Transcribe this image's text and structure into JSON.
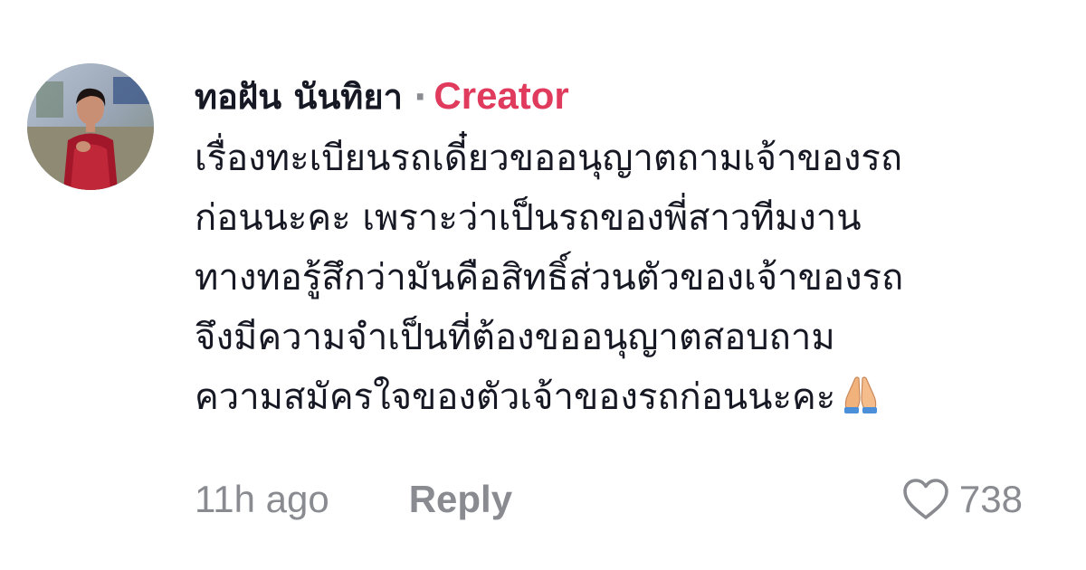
{
  "comment": {
    "username": "ทอฝัน นันทิยา",
    "separator": "·",
    "badge": "Creator",
    "text_lines": [
      "เรื่องทะเบียนรถเดี๋ยวขออนุญาตถามเจ้าของรถ",
      "ก่อนนะคะ เพราะว่าเป็นรถของพี่สาวทีมงาน",
      "ทางทอรู้สึกว่ามันคือสิทธิ์ส่วนตัวของเจ้าของรถ",
      "จึงมีความจำเป็นที่ต้องขออนุญาตสอบถาม",
      "ความสมัครใจของตัวเจ้าของรถก่อนนะคะ"
    ],
    "emoji": "folded-hands-emoji",
    "time": "11h ago",
    "reply_label": "Reply",
    "like_icon": "heart-outline-icon",
    "like_count": "738"
  },
  "colors": {
    "creator_badge": "#e03a5d",
    "meta_text": "#8a8b91",
    "body_text": "#161823"
  }
}
